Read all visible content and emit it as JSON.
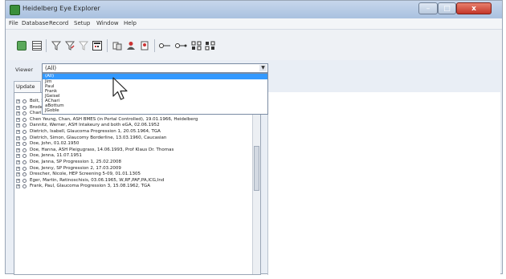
{
  "window": {
    "title": "Heidelberg Eye Explorer",
    "min_glyph": "–",
    "max_glyph": "□",
    "close_glyph": "x"
  },
  "menu": {
    "items": [
      "File",
      "Database",
      "Record",
      "Setup",
      "Window",
      "Help"
    ]
  },
  "toolbar": {
    "icons": [
      "patient-list-icon",
      "database-icon",
      "filter-icon",
      "filter-edit-icon",
      "filter-clear-icon",
      "calendar-icon",
      "merge-icon",
      "person-icon",
      "person-import-icon",
      "connect-icon",
      "connect-multiple-icon",
      "network-icon",
      "network-multiple-icon"
    ]
  },
  "viewer": {
    "label": "Viewer",
    "selected": "(All)",
    "options": [
      "(All)",
      "Jim",
      "Paul",
      "Frank",
      "JGeisel",
      "AChari",
      "aBottum",
      "JGoble"
    ]
  },
  "update_tab_label": "Update",
  "patients": [
    "Bolt, Stefanie,  SP 92-0527 Geographic Atrophy, 02.07.1956",
    "Brodersen, Henrik,   Glaucom with soft DL, 11.11.1951",
    "Chari, Kim,  ASH Filtering Bleb, 15.06.1967, Dr. Thaden",
    "Chen Yeung, Chan,  ASH BMES (in Portal Controlled), 19.01.1966, Heidelberg",
    "Dannitz, Werner,  ASH Intakeury and both eGA, 02.06.1952",
    "Dietrich, Isabell,  Glaucoma Progression 1, 20.05.1964, TGA",
    "Dietrich, Simon,  Glaucomy Borderline, 13.03.1960, Caucasian",
    "Doe, John, 01.02.1950",
    "Doe, Hanna,  ASH Pleigugrass, 14.06.1993, Prof Klaus Dr. Thomas",
    "Doe, Jenna, 11.07.1951",
    "Doe, Janna,  SP Progression 1, 25.02.2008",
    "Doe, Jenny,  SP Progression 2, 17.03.2009",
    "Drescher, Nicole,  HEP Screening 5-09, 01.01.1305",
    "Eger, Martin,  Retinoschisis, 03.06.1965, W,RF,PAF,PA,ICG,Ind",
    "Frank, Paul,  Glaucoma Progression 3, 15.08.1962, TGA"
  ],
  "colors": {
    "selection": "#3399ff",
    "close_button": "#c4372a",
    "titlebar": "#b8cce6"
  }
}
